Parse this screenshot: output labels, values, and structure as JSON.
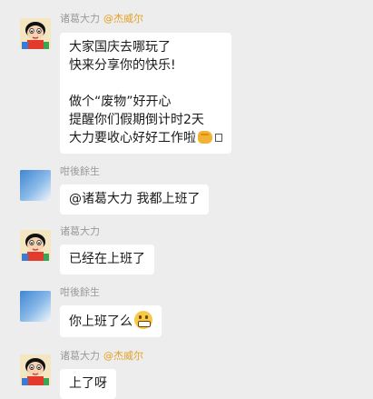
{
  "messages": [
    {
      "sender": "诸葛大力",
      "mention": "@杰威尔",
      "avatar": "shinchan-avatar",
      "lines": [
        "大家国庆去哪玩了",
        "快来分享你的快乐!",
        "",
        "做个“废物”好开心",
        "提醒你们假期倒计时2天",
        "大力要收心好好工作啦"
      ],
      "emoji": "fist-emoji"
    },
    {
      "sender": "咁後餘生",
      "avatar": "sky-avatar",
      "text": "@诸葛大力 我都上班了"
    },
    {
      "sender": "诸葛大力",
      "avatar": "shinchan-avatar",
      "text": "已经在上班了"
    },
    {
      "sender": "咁後餘生",
      "avatar": "sky-avatar",
      "text": "你上班了么",
      "emoji": "grin-emoji"
    },
    {
      "sender": "诸葛大力",
      "mention": "@杰威尔",
      "avatar": "shinchan-avatar",
      "text": "上了呀"
    }
  ],
  "colors": {
    "background": "#ededed",
    "bubble": "#ffffff",
    "sender_name": "#9a9a9a",
    "mention": "#e3a021"
  }
}
